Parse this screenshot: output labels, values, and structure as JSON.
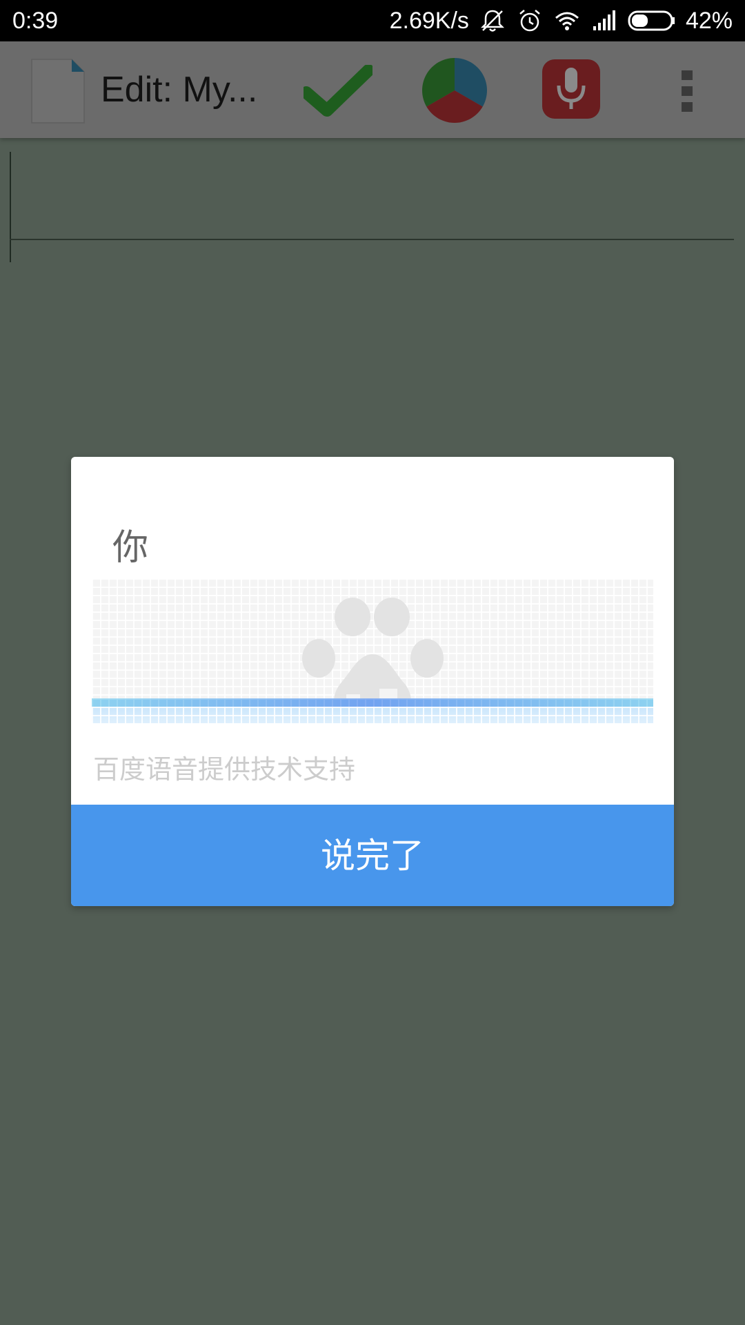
{
  "status_bar": {
    "time": "0:39",
    "net_speed": "2.69K/s",
    "battery_percent": "42%",
    "battery_level": 0.42,
    "icons": [
      "bell-off-icon",
      "alarm-icon",
      "wifi-icon",
      "signal-icon",
      "battery-icon"
    ]
  },
  "app_bar": {
    "title": "Edit: My...",
    "actions": [
      "document-icon",
      "checkmark-icon",
      "pie-chart-icon",
      "microphone-icon",
      "overflow-menu-icon"
    ],
    "colors": {
      "check": "#2e8b2e",
      "mic": "#c0262b",
      "pie_blue": "#2b8ec4",
      "pie_green": "#2f9a3a",
      "pie_red": "#c0262b"
    }
  },
  "dialog": {
    "recognized_text": "你",
    "logo_icon": "baidu-paw-icon",
    "credit": "百度语音提供技术支持",
    "done_label": "说完了",
    "accent": "#4896ec"
  }
}
